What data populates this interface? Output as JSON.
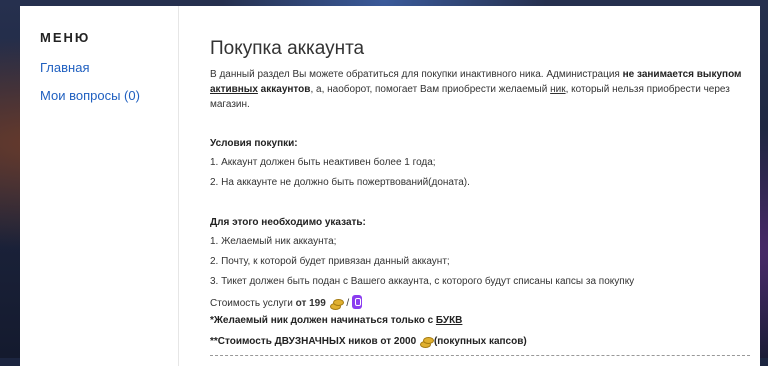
{
  "sidebar": {
    "title": "МЕНЮ",
    "items": [
      {
        "label": "Главная"
      },
      {
        "label": "Мои вопросы (0)"
      }
    ]
  },
  "main": {
    "title": "Покупка аккаунта",
    "intro": {
      "p1": "В данный раздел Вы можете обратиться для покупки инактивного ника. Администрация ",
      "bold1": "не занимается выкупом",
      "bold2_u": "активных",
      "bold3": " аккаунтов",
      "p2": ", а, наоборот, помогает Вам приобрести желаемый ",
      "nick": "ник",
      "p3": ", который нельзя приобрести через магазин."
    },
    "conditions": {
      "title": "Условия покупки:",
      "items": [
        "1. Аккаунт должен быть неактивен более 1 года;",
        "2. На аккаунте не должно быть пожертвований(доната)."
      ]
    },
    "requirements": {
      "title": "Для этого необходимо указать:",
      "items": [
        "1. Желаемый ник аккаунта;",
        "2. Почту, к которой будет привязан данный аккаунт;",
        "3. Тикет должен быть подан с Вашего аккаунта, с которого будут списаны капсы за покупку"
      ]
    },
    "price": {
      "prefix": "Стоимость услуги ",
      "value": "от 199",
      "sep": " /"
    },
    "note1": {
      "text": "*Желаемый ник должен начинаться только с ",
      "word": "БУКВ"
    },
    "note2": {
      "text": "**Стоимость ДВУЗНАЧНЫХ ников от 2000",
      "suffix": "(покупных капсов)"
    }
  }
}
